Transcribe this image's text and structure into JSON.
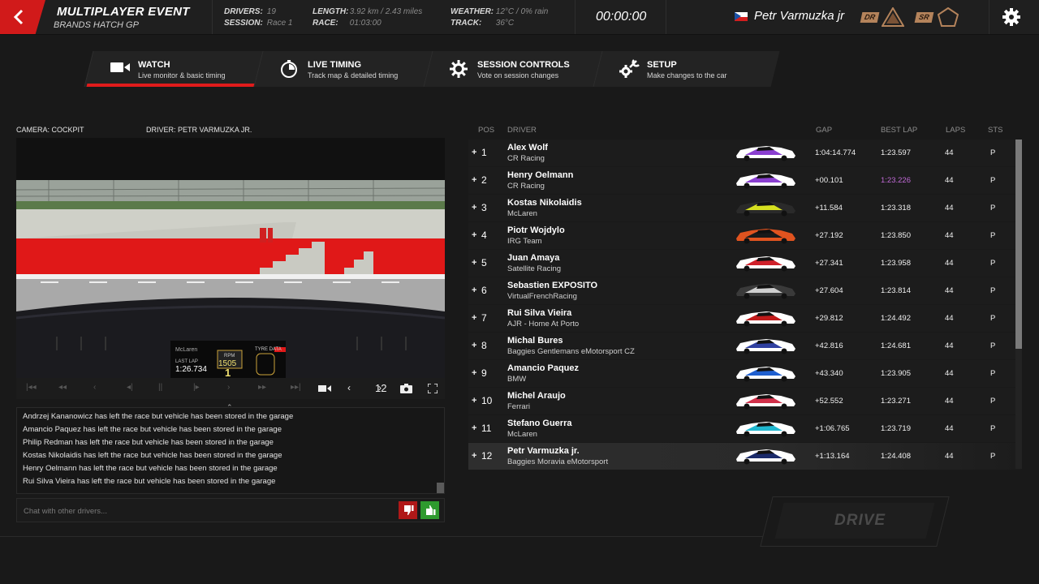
{
  "header": {
    "title": "MULTIPLAYER EVENT",
    "subtitle": "BRANDS HATCH GP",
    "drivers_label": "DRIVERS:",
    "drivers_value": "19",
    "session_label": "SESSION:",
    "session_value": "Race 1",
    "length_label": "LENGTH:",
    "length_value": "3.92 km / 2.43 miles",
    "race_label": "RACE:",
    "race_value": "01:03:00",
    "weather_label": "WEATHER:",
    "weather_value": "12°C / 0% rain",
    "track_label": "TRACK:",
    "track_value": "36°C",
    "timer": "00:00:00",
    "user": "Petr Varmuzka jr",
    "dr_badge": "DR",
    "sr_badge": "SR"
  },
  "tabs": [
    {
      "title": "WATCH",
      "subtitle": "Live monitor & basic timing",
      "active": true
    },
    {
      "title": "LIVE TIMING",
      "subtitle": "Track map & detailed timing",
      "active": false
    },
    {
      "title": "SESSION CONTROLS",
      "subtitle": "Vote on session changes",
      "active": false
    },
    {
      "title": "SETUP",
      "subtitle": "Make changes to the car",
      "active": false
    }
  ],
  "watch": {
    "camera": "CAMERA: COCKPIT",
    "driver": "DRIVER: PETR VARMUZKA JR.",
    "car_number": "12",
    "dash": {
      "lap_label": "LAST LAP",
      "lap_time": "1:26.734",
      "rpm_label": "RPM",
      "rpm": "1505",
      "gear": "1",
      "tyre_label": "TYRE DATA",
      "brand": "McLaren"
    }
  },
  "log": [
    "Andrzej Kananowicz has left the race but vehicle has been stored in the garage",
    "Amancio Paquez has left the race but vehicle has been stored in the garage",
    "Philip Redman has left the race but vehicle has been stored in the garage",
    "Kostas Nikolaidis has left the race but vehicle has been stored in the garage",
    "Henry Oelmann has left the race but vehicle has been stored in the garage",
    "Rui Silva Vieira has left the race but vehicle has been stored in the garage"
  ],
  "chat": {
    "placeholder": "Chat with other drivers..."
  },
  "standings": {
    "headers": {
      "pos": "POS",
      "driver": "DRIVER",
      "gap": "GAP",
      "best": "BEST LAP",
      "laps": "LAPS",
      "sts": "STS"
    },
    "rows": [
      {
        "pos": "1",
        "name": "Alex Wolf",
        "team": "CR Racing",
        "gap": "1:04:14.774",
        "best": "1:23.597",
        "laps": "44",
        "sts": "P",
        "c1": "#ffffff",
        "c2": "#8a3fd0"
      },
      {
        "pos": "2",
        "name": "Henry Oelmann",
        "team": "CR Racing",
        "gap": "+00.101",
        "best": "1:23.226",
        "best_purple": true,
        "laps": "44",
        "sts": "P",
        "c1": "#ffffff",
        "c2": "#8a3fd0"
      },
      {
        "pos": "3",
        "name": "Kostas Nikolaidis",
        "team": "McLaren",
        "gap": "+11.584",
        "best": "1:23.318",
        "laps": "44",
        "sts": "P",
        "c1": "#2a2a2a",
        "c2": "#d6e020"
      },
      {
        "pos": "4",
        "name": "Piotr Wojdylo",
        "team": "IRG Team",
        "gap": "+27.192",
        "best": "1:23.850",
        "laps": "44",
        "sts": "P",
        "c1": "#e0531f",
        "c2": "#1a1a1a"
      },
      {
        "pos": "5",
        "name": "Juan Amaya",
        "team": "Satellite Racing",
        "gap": "+27.341",
        "best": "1:23.958",
        "laps": "44",
        "sts": "P",
        "c1": "#ffffff",
        "c2": "#d0202a"
      },
      {
        "pos": "6",
        "name": "Sebastien EXPOSITO",
        "team": "VirtualFrenchRacing",
        "gap": "+27.604",
        "best": "1:23.814",
        "laps": "44",
        "sts": "P",
        "c1": "#3a3a3a",
        "c2": "#cfcfcf"
      },
      {
        "pos": "7",
        "name": "Rui Silva Vieira",
        "team": "AJR - Home At Porto",
        "gap": "+29.812",
        "best": "1:24.492",
        "laps": "44",
        "sts": "P",
        "c1": "#ffffff",
        "c2": "#c01a1a"
      },
      {
        "pos": "8",
        "name": "Michal Bures",
        "team": "Baggies Gentlemans eMotorsport CZ",
        "gap": "+42.816",
        "best": "1:24.681",
        "laps": "44",
        "sts": "P",
        "c1": "#ffffff",
        "c2": "#3040a0"
      },
      {
        "pos": "9",
        "name": "Amancio Paquez",
        "team": "BMW",
        "gap": "+43.340",
        "best": "1:23.905",
        "laps": "44",
        "sts": "P",
        "c1": "#ffffff",
        "c2": "#1e5fd0"
      },
      {
        "pos": "10",
        "name": "Michel Araujo",
        "team": "Ferrari",
        "gap": "+52.552",
        "best": "1:23.271",
        "laps": "44",
        "sts": "P",
        "c1": "#ffffff",
        "c2": "#d0304a"
      },
      {
        "pos": "11",
        "name": "Stefano Guerra",
        "team": "McLaren",
        "gap": "+1:06.765",
        "best": "1:23.719",
        "laps": "44",
        "sts": "P",
        "c1": "#ffffff",
        "c2": "#20b8d0"
      },
      {
        "pos": "12",
        "name": "Petr Varmuzka jr.",
        "team": "Baggies Moravia eMotorsport",
        "gap": "+1:13.164",
        "best": "1:24.408",
        "laps": "44",
        "sts": "P",
        "c1": "#ffffff",
        "c2": "#1a2a6a",
        "me": true
      }
    ]
  },
  "drive_label": "DRIVE",
  "colors": {
    "accent": "#e01b1b",
    "fastest_lap": "#c06ad6",
    "vote_down": "#b01818",
    "vote_up": "#2e9a2e"
  }
}
